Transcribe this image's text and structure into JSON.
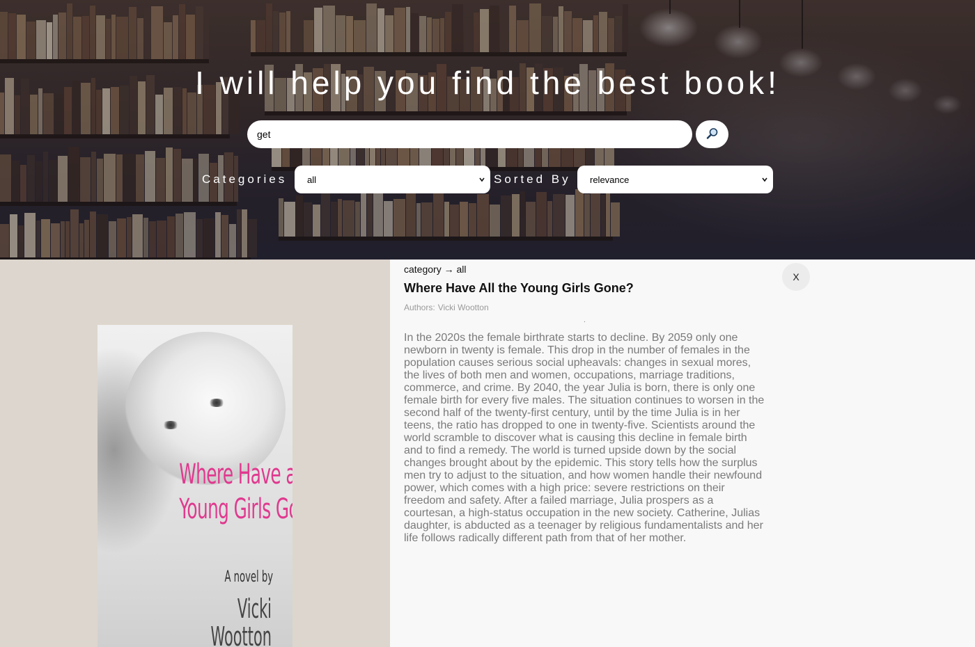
{
  "header": {
    "headline": "I will help you find the best book!",
    "search": {
      "value": "get",
      "placeholder": ""
    },
    "search_button_icon": "search-icon",
    "categories_label": "Categories",
    "categories_selected": "all",
    "sorted_by_label": "Sorted By",
    "sorted_by_selected": "relevance"
  },
  "detail": {
    "breadcrumb": "category → all",
    "title": "Where Have All the Young Girls Gone?",
    "authors_prefix": "Authors:",
    "authors": "Vicki Wootton",
    "separator": ".",
    "description": "In the 2020s the female birthrate starts to decline. By 2059 only one newborn in twenty is female. This drop in the number of females in the population causes serious social upheavals: changes in sexual mores, the lives of both men and women, occupations, marriage traditions, commerce, and crime. By 2040, the year Julia is born, there is only one female birth for every five males. The situation continues to worsen in the second half of the twenty-first century, until by the time Julia is in her teens, the ratio has dropped to one in twenty-five. Scientists around the world scramble to discover what is causing this decline in female birth and to find a remedy. The world is turned upside down by the social changes brought about by the epidemic. This story tells how the surplus men try to adjust to the situation, and how women handle their newfound power, which comes with a high price: severe restrictions on their freedom and safety. After a failed marriage, Julia prospers as a courtesan, a high-status occupation in the new society. Catherine, Julias daughter, is abducted as a teenager by religious fundamentalists and her life follows radically different path from that of her mother.",
    "close_label": "X",
    "cover": {
      "title_line1": "Where Have all the",
      "title_line2": "Young Girls Gone?",
      "subtitle": "A novel by",
      "author_line1": "Vicki",
      "author_line2": "Wootton"
    }
  },
  "colors": {
    "cover_title": "#e0398f",
    "cover_pane_bg": "#ddd6ce",
    "detail_bg": "#f8f8f8",
    "description_text": "#7a7a7a",
    "authors_text": "#9a9a9a"
  }
}
